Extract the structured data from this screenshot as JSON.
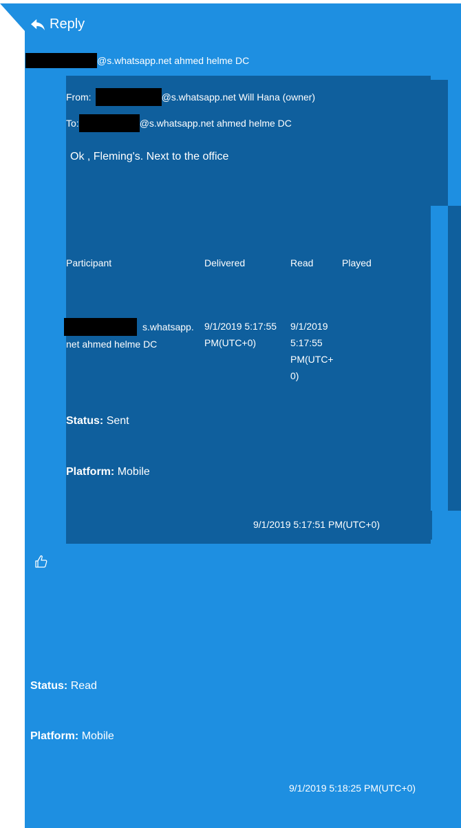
{
  "header": {
    "reply_label": "Reply"
  },
  "sender_line": {
    "suffix": "@s.whatsapp.net ahmed helme DC"
  },
  "quoted": {
    "from_label": "From:",
    "from_suffix": "@s.whatsapp.net Will Hana (owner)",
    "to_label": "To:",
    "to_suffix": "@s.whatsapp.net ahmed helme DC",
    "message": "Ok , Fleming's. Next to the office",
    "columns": [
      "Participant",
      "Delivered",
      "Read",
      "Played"
    ],
    "row": {
      "participant_l1": "s.whatsapp.",
      "participant_l2": "net ahmed helme DC",
      "delivered_l1": "9/1/2019   5:17:55",
      "delivered_l2": "PM(UTC+0)",
      "read_l1": "9/1/2019",
      "read_l2": "5:17:55",
      "read_l3": "PM(UTC+",
      "read_l4": "0)"
    },
    "status_label": "Status:",
    "status_value": "Sent",
    "platform_label": "Platform:",
    "platform_value": "Mobile",
    "timestamp": "9/1/2019 5:17:51 PM(UTC+0)"
  },
  "outer": {
    "status_label": "Status:",
    "status_value": "Read",
    "platform_label": "Platform:",
    "platform_value": "Mobile",
    "timestamp": "9/1/2019 5:18:25 PM(UTC+0)"
  },
  "colors": {
    "bubble": "#1e8fe1",
    "quoted": "#0f5f9d",
    "redaction": "#000000"
  },
  "icons": {
    "reply": "reply-arrow-icon",
    "reaction": "thumbs-up-icon"
  }
}
